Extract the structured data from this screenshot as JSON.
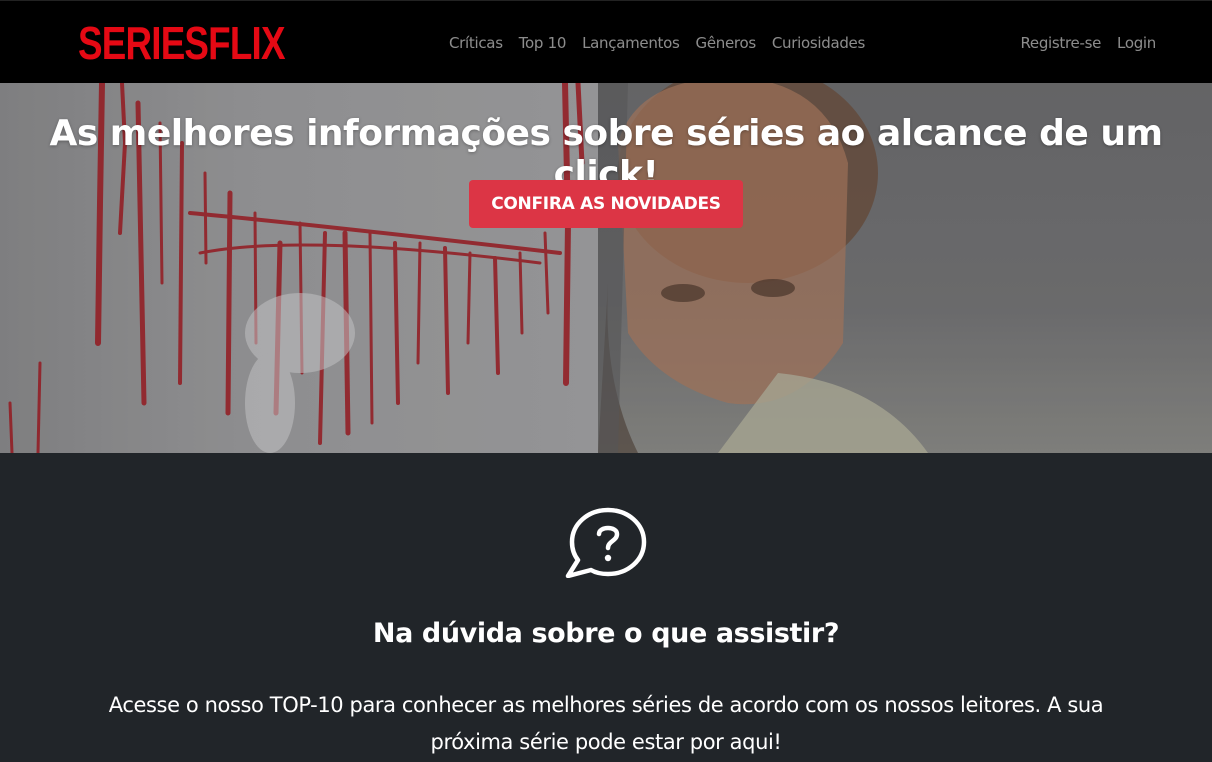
{
  "brand": {
    "logo_text": "SERIESFLIX",
    "color": "#e50914"
  },
  "nav": {
    "links": [
      "Críticas",
      "Top 10",
      "Lançamentos",
      "Gêneros",
      "Curiosidades"
    ],
    "right": [
      "Registre-se",
      "Login"
    ]
  },
  "hero": {
    "title": "As melhores informações sobre séries ao alcance de um click!",
    "button_label": "CONFIRA AS NOVIDADES",
    "button_color": "#dc3545"
  },
  "info": {
    "icon": "question-chat-icon",
    "title": "Na dúvida sobre o que assistir?",
    "text": "Acesse o nosso TOP-10 para conhecer as melhores séries de acordo com os nossos leitores. A sua próxima série pode estar por aqui!"
  }
}
